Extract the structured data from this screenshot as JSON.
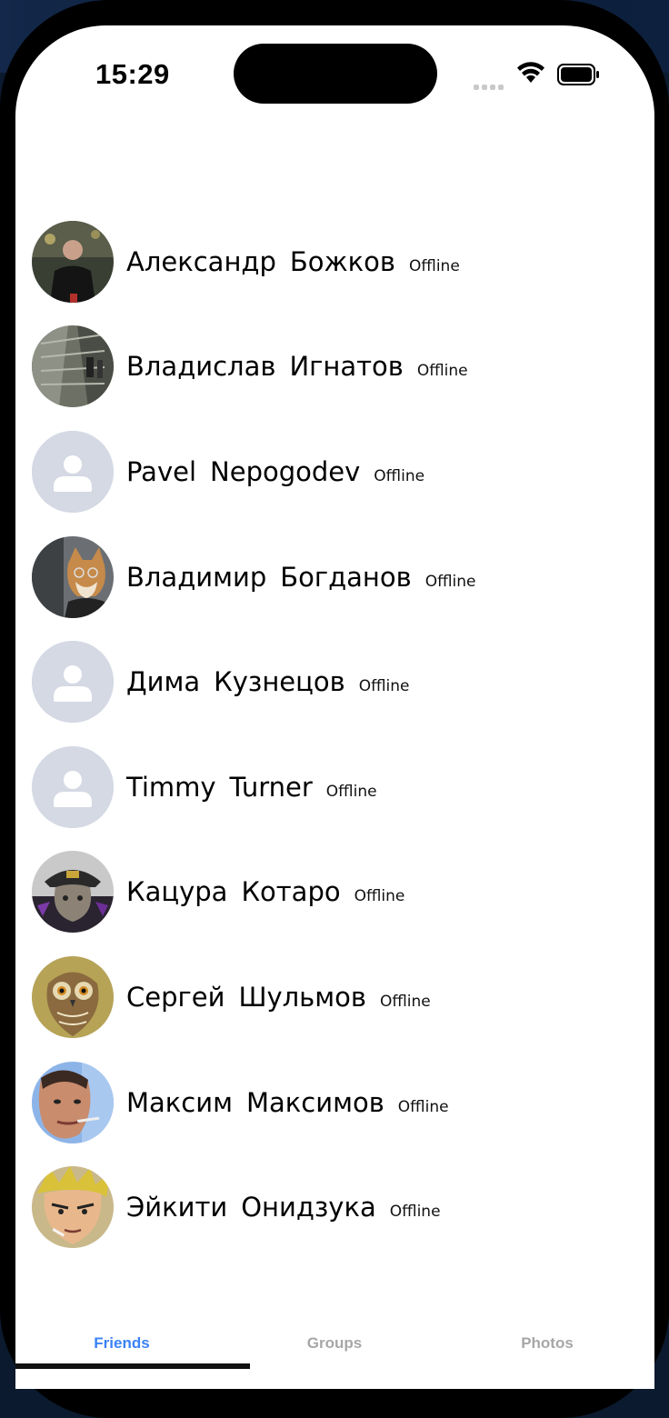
{
  "status_bar": {
    "time": "15:29"
  },
  "friends": [
    {
      "first": "Александр",
      "last": "Божков",
      "status": "Offline",
      "avatar": "photo-man-dark-jacket"
    },
    {
      "first": "Владислав",
      "last": "Игнатов",
      "status": "Offline",
      "avatar": "photo-escalator"
    },
    {
      "first": "Pavel",
      "last": "Nepogodev",
      "status": "Offline",
      "avatar": "default-person-icon"
    },
    {
      "first": "Владимир",
      "last": "Богданов",
      "status": "Offline",
      "avatar": "photo-shiba-dog"
    },
    {
      "first": "Дима",
      "last": "Кузнецов",
      "status": "Offline",
      "avatar": "default-person-icon"
    },
    {
      "first": "Timmy",
      "last": "Turner",
      "status": "Offline",
      "avatar": "default-person-icon"
    },
    {
      "first": "Кацура",
      "last": "Котаро",
      "status": "Offline",
      "avatar": "photo-cat-hat"
    },
    {
      "first": "Сергей",
      "last": "Шульмов",
      "status": "Offline",
      "avatar": "photo-owl"
    },
    {
      "first": "Максим",
      "last": "Максимов",
      "status": "Offline",
      "avatar": "photo-man-selfie"
    },
    {
      "first": "Эйкити",
      "last": "Онидзука",
      "status": "Offline",
      "avatar": "photo-anime-character"
    }
  ],
  "tabs": [
    {
      "label": "Friends",
      "active": true
    },
    {
      "label": "Groups",
      "active": false
    },
    {
      "label": "Photos",
      "active": false
    }
  ],
  "colors": {
    "accent": "#3b82f6",
    "inactive_tab": "#a7a7a7",
    "default_avatar_bg": "#d4d9e4",
    "default_avatar_fg": "#ffffff"
  }
}
